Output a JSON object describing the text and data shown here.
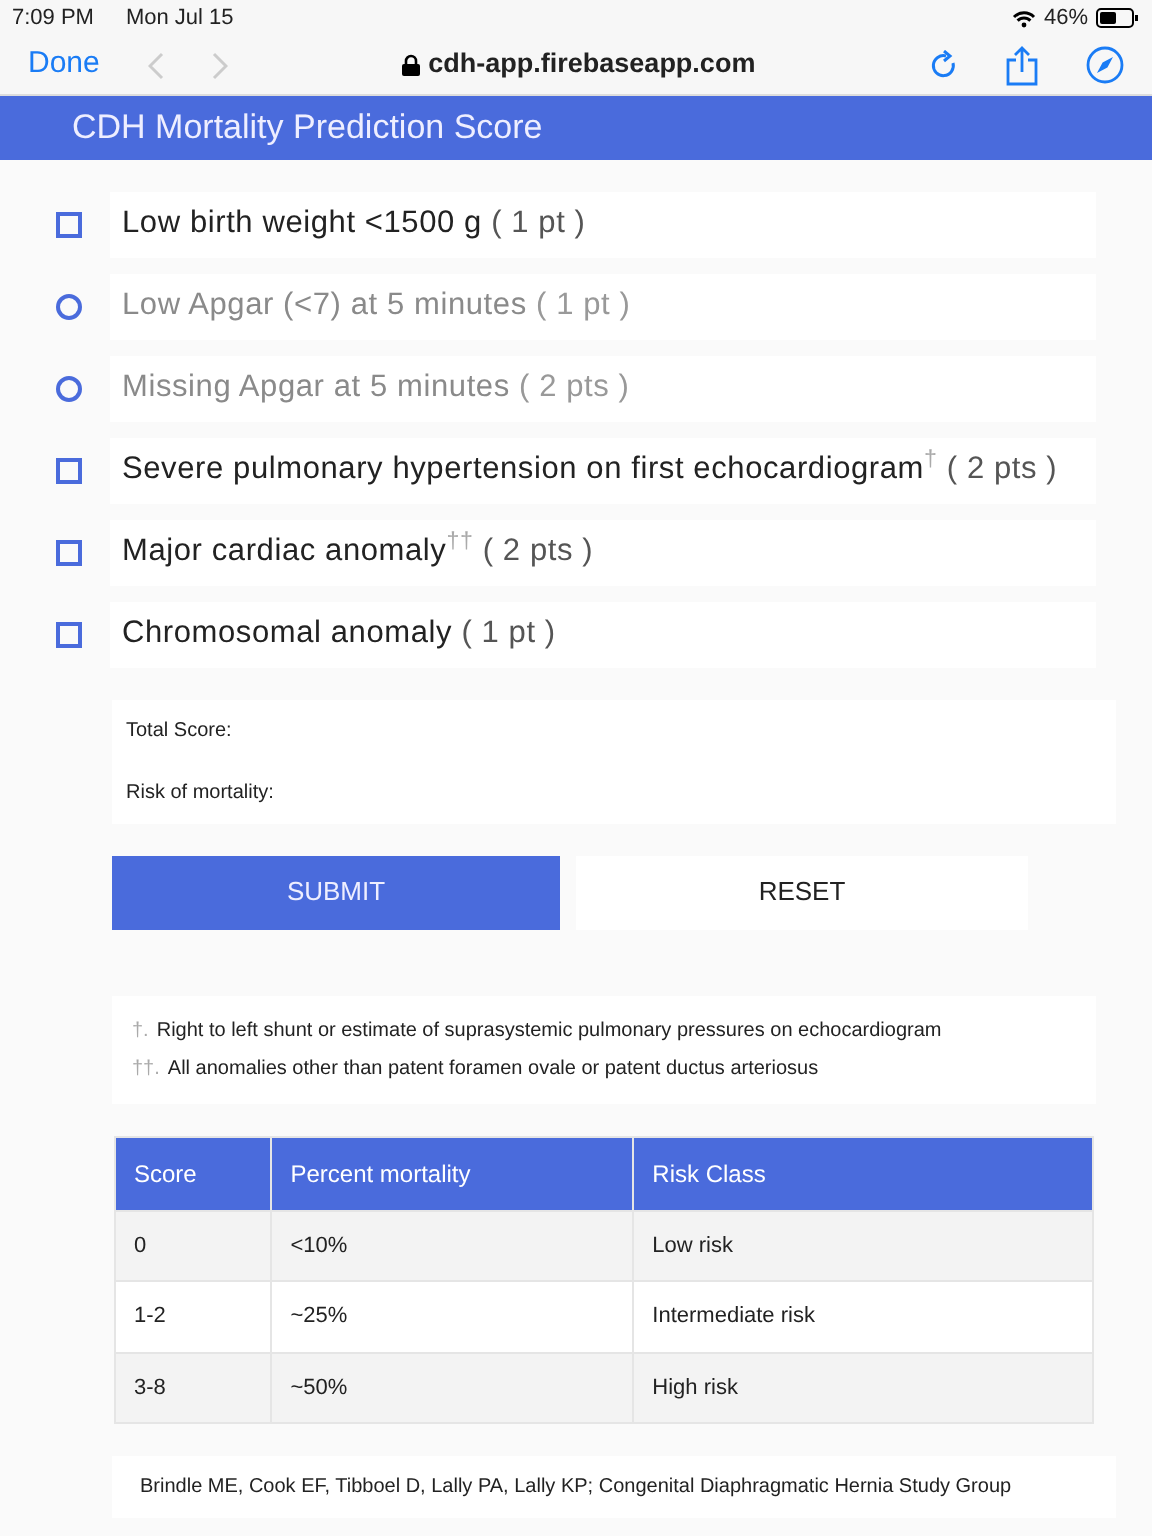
{
  "status_bar": {
    "time": "7:09 PM",
    "date": "Mon Jul 15",
    "battery": "46%"
  },
  "browser": {
    "done": "Done",
    "url": "cdh-app.firebaseapp.com"
  },
  "header": {
    "title": "CDH Mortality Prediction Score"
  },
  "criteria": [
    {
      "kind": "checkbox",
      "label": "Low birth weight <1500 g",
      "points": "( 1 pt )",
      "checked": false,
      "disabled": false
    },
    {
      "kind": "radio",
      "label": "Low Apgar (<7) at 5 minutes",
      "points": "( 1 pt )",
      "checked": false,
      "disabled": true
    },
    {
      "kind": "radio",
      "label": "Missing Apgar at 5 minutes",
      "points": "( 2 pts )",
      "checked": false,
      "disabled": true
    },
    {
      "kind": "checkbox",
      "label": "Severe pulmonary hypertension on first echocardiogram$^{†}$",
      "points": "( 2 pts )",
      "checked": false,
      "disabled": false
    },
    {
      "kind": "checkbox",
      "label": "Major cardiac anomaly$^{††}$",
      "points": "( 2 pts )",
      "checked": false,
      "disabled": false
    },
    {
      "kind": "checkbox",
      "label": "Chromosomal anomaly",
      "points": "( 1 pt )",
      "checked": false,
      "disabled": false
    }
  ],
  "results": [
    "Total Score:",
    "Risk of mortality:"
  ],
  "buttons": [
    {
      "kind": "primary",
      "label": "SUBMIT"
    },
    {
      "kind": "secondary",
      "label": "RESET"
    }
  ],
  "footnotes": [
    {
      "mark": "†.",
      "text": "Right to left shunt or estimate of suprasystemic pulmonary pressures on echocardiogram"
    },
    {
      "mark": "††.",
      "text": "All anomalies other than patent foramen ovale or patent ductus arteriosus"
    }
  ],
  "table": {
    "columns": [
      "Score",
      "Percent mortality",
      "Risk Class"
    ],
    "rows": [
      [
        "0",
        "<10%",
        "Low risk"
      ],
      [
        "1-2",
        "~25%",
        "Intermediate risk"
      ],
      [
        "3-8",
        "~50%",
        "High risk"
      ]
    ]
  },
  "reference": "Brindle ME, Cook EF, Tibboel D, Lally PA, Lally KP; Congenital Diaphragmatic Hernia Study Group"
}
